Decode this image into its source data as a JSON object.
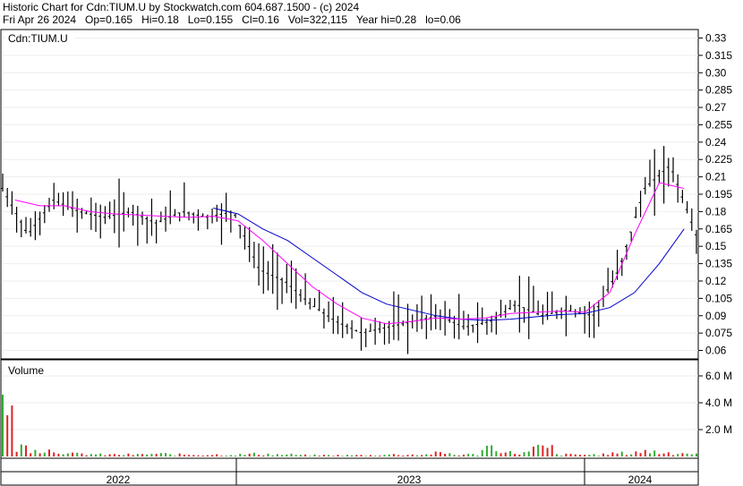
{
  "header": {
    "line1": "Historic Chart for Cdn:TIUM.U by Stockwatch.com 604.687.1500 - (c) 2024",
    "line2": "Fri Apr 26 2024   Op=0.165   Hi=0.18   Lo=0.155   Cl=0.16   Vol=322,115   Year hi=0.28   lo=0.06"
  },
  "price_panel": {
    "symbol_label": "Cdn:TIUM.U",
    "y_ticks": [
      "0.33",
      "0.315",
      "0.30",
      "0.285",
      "0.27",
      "0.255",
      "0.24",
      "0.225",
      "0.21",
      "0.195",
      "0.18",
      "0.165",
      "0.15",
      "0.135",
      "0.12",
      "0.105",
      "0.09",
      "0.075",
      "0.06"
    ]
  },
  "volume_panel": {
    "label": "Volume",
    "y_ticks": [
      "6.0 M",
      "4.0 M",
      "2.0 M"
    ]
  },
  "x_axis": {
    "years": [
      "2022",
      "2023",
      "2024"
    ]
  },
  "colors": {
    "bars": "#000000",
    "ma_short": "#ff00ff",
    "ma_long": "#0000cc",
    "volume_up": "#33aa33",
    "volume_down": "#dd2222"
  },
  "chart_data": {
    "type": "line",
    "title": "Historic Chart for Cdn:TIUM.U",
    "ylim": [
      0.055,
      0.335
    ],
    "x": [
      "2022-01",
      "2022-02",
      "2022-03",
      "2022-04",
      "2022-05",
      "2022-06",
      "2022-07",
      "2022-08",
      "2022-09",
      "2022-10",
      "2022-11",
      "2022-12",
      "2023-01",
      "2023-02",
      "2023-03",
      "2023-04",
      "2023-05",
      "2023-06",
      "2023-07",
      "2023-08",
      "2023-09",
      "2023-10",
      "2023-11",
      "2023-12",
      "2024-01",
      "2024-02",
      "2024-03",
      "2024-04"
    ],
    "series": [
      {
        "values": [
          0.2,
          0.16,
          0.19,
          0.18,
          0.175,
          0.18,
          0.17,
          0.18,
          0.175,
          0.18,
          0.13,
          0.12,
          0.1,
          0.085,
          0.075,
          0.08,
          0.085,
          0.09,
          0.08,
          0.085,
          0.1,
          0.09,
          0.095,
          0.09,
          0.13,
          0.2,
          0.22,
          0.16
        ]
      },
      {
        "values": [
          0.19,
          0.185,
          0.185,
          0.18,
          0.178,
          0.177,
          0.176,
          0.175,
          0.176,
          0.172,
          0.155,
          0.135,
          0.115,
          0.1,
          0.088,
          0.083,
          0.085,
          0.088,
          0.087,
          0.088,
          0.092,
          0.093,
          0.094,
          0.093,
          0.11,
          0.16,
          0.205,
          0.2
        ]
      },
      {
        "values": [
          null,
          null,
          null,
          null,
          null,
          null,
          null,
          null,
          0.183,
          0.178,
          0.165,
          0.155,
          0.14,
          0.125,
          0.11,
          0.1,
          0.095,
          0.09,
          0.087,
          0.086,
          0.087,
          0.089,
          0.091,
          0.092,
          0.097,
          0.11,
          0.135,
          0.165
        ]
      }
    ],
    "volume": {
      "ylim": [
        0,
        7.0
      ],
      "values": [
        5.8,
        1.5,
        1.0,
        0.4,
        0.3,
        0.3,
        0.4,
        0.3,
        0.3,
        0.3,
        0.4,
        0.3,
        0.2,
        0.2,
        0.2,
        0.3,
        0.3,
        0.5,
        0.3,
        1.5,
        0.6,
        1.3,
        0.3,
        0.3,
        0.5,
        0.8,
        0.6,
        0.5
      ]
    }
  }
}
